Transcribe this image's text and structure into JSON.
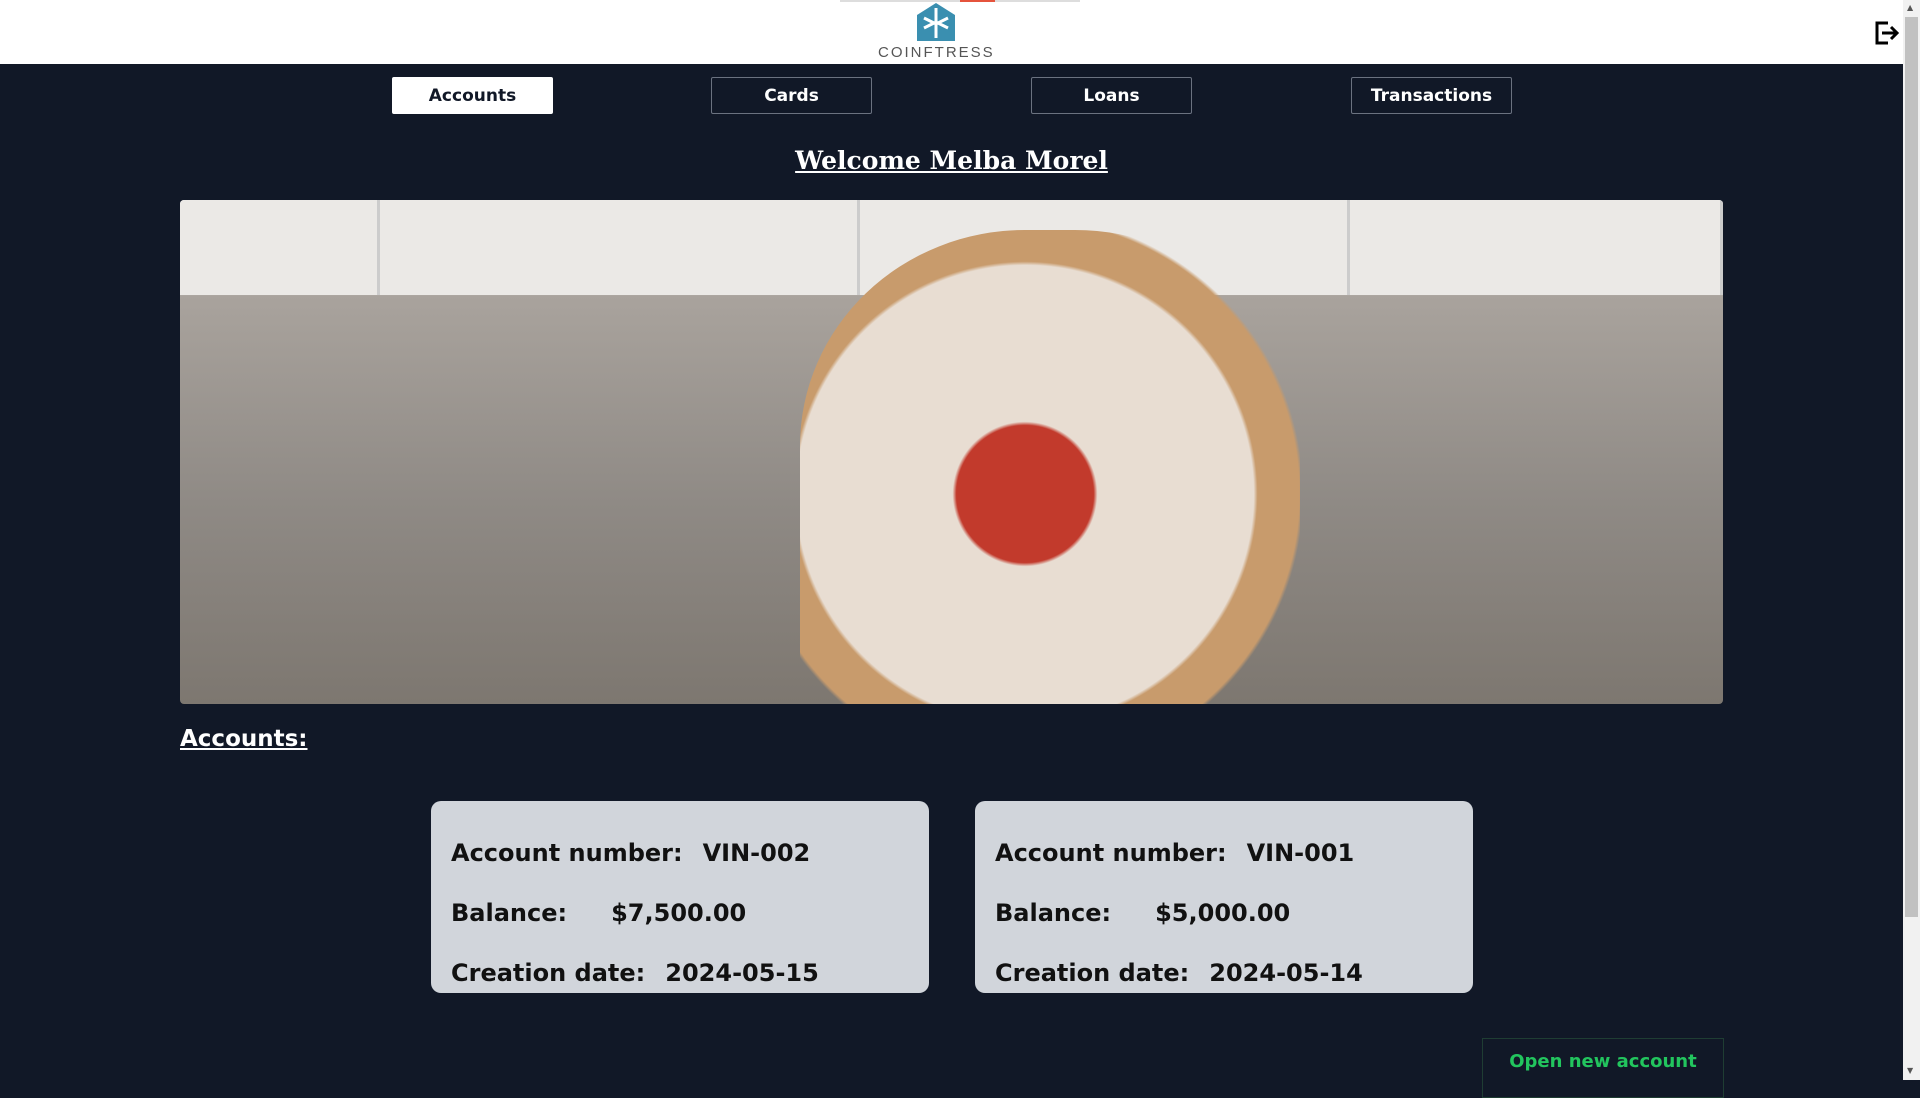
{
  "header": {
    "brand": "COINFTRESS",
    "logout_icon": "logout-icon"
  },
  "nav": {
    "tabs": [
      {
        "label": "Accounts",
        "active": true
      },
      {
        "label": "Cards"
      },
      {
        "label": "Loans"
      },
      {
        "label": "Transactions"
      }
    ]
  },
  "welcome": "Welcome Melba Morel",
  "hero": {
    "icon": "hero-photo"
  },
  "accounts": {
    "title": "Accounts:",
    "labels": {
      "number": "Account number:",
      "balance": "Balance:",
      "date": "Creation date:"
    },
    "items": [
      {
        "number": "VIN-002",
        "balance": "$7,500.00",
        "date": "2024-05-15"
      },
      {
        "number": "VIN-001",
        "balance": "$5,000.00",
        "date": "2024-05-14"
      }
    ],
    "open_button": "Open new account"
  },
  "colors": {
    "bg": "#111827",
    "card": "#d1d5db",
    "accent": "#22c55e"
  }
}
